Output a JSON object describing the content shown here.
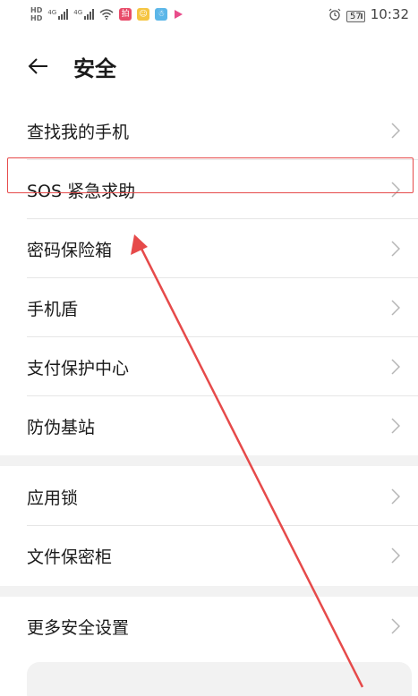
{
  "status_bar": {
    "net_tags": [
      "HD",
      "HD"
    ],
    "sim1": "4G",
    "sim2": "4G",
    "battery": "57",
    "time": "10:32"
  },
  "header": {
    "title": "安全"
  },
  "groups": [
    {
      "items": [
        {
          "label": "查找我的手机"
        },
        {
          "label": "SOS 紧急求助"
        },
        {
          "label": "密码保险箱"
        },
        {
          "label": "手机盾"
        },
        {
          "label": "支付保护中心"
        },
        {
          "label": "防伪基站"
        }
      ]
    },
    {
      "items": [
        {
          "label": "应用锁"
        },
        {
          "label": "文件保密柜"
        }
      ]
    },
    {
      "items": [
        {
          "label": "更多安全设置"
        }
      ]
    }
  ],
  "colors": {
    "annotation": "#e64a4a",
    "text": "#1a1a1a",
    "chevron": "#b5b5b5",
    "group_gap": "#f2f2f2"
  }
}
